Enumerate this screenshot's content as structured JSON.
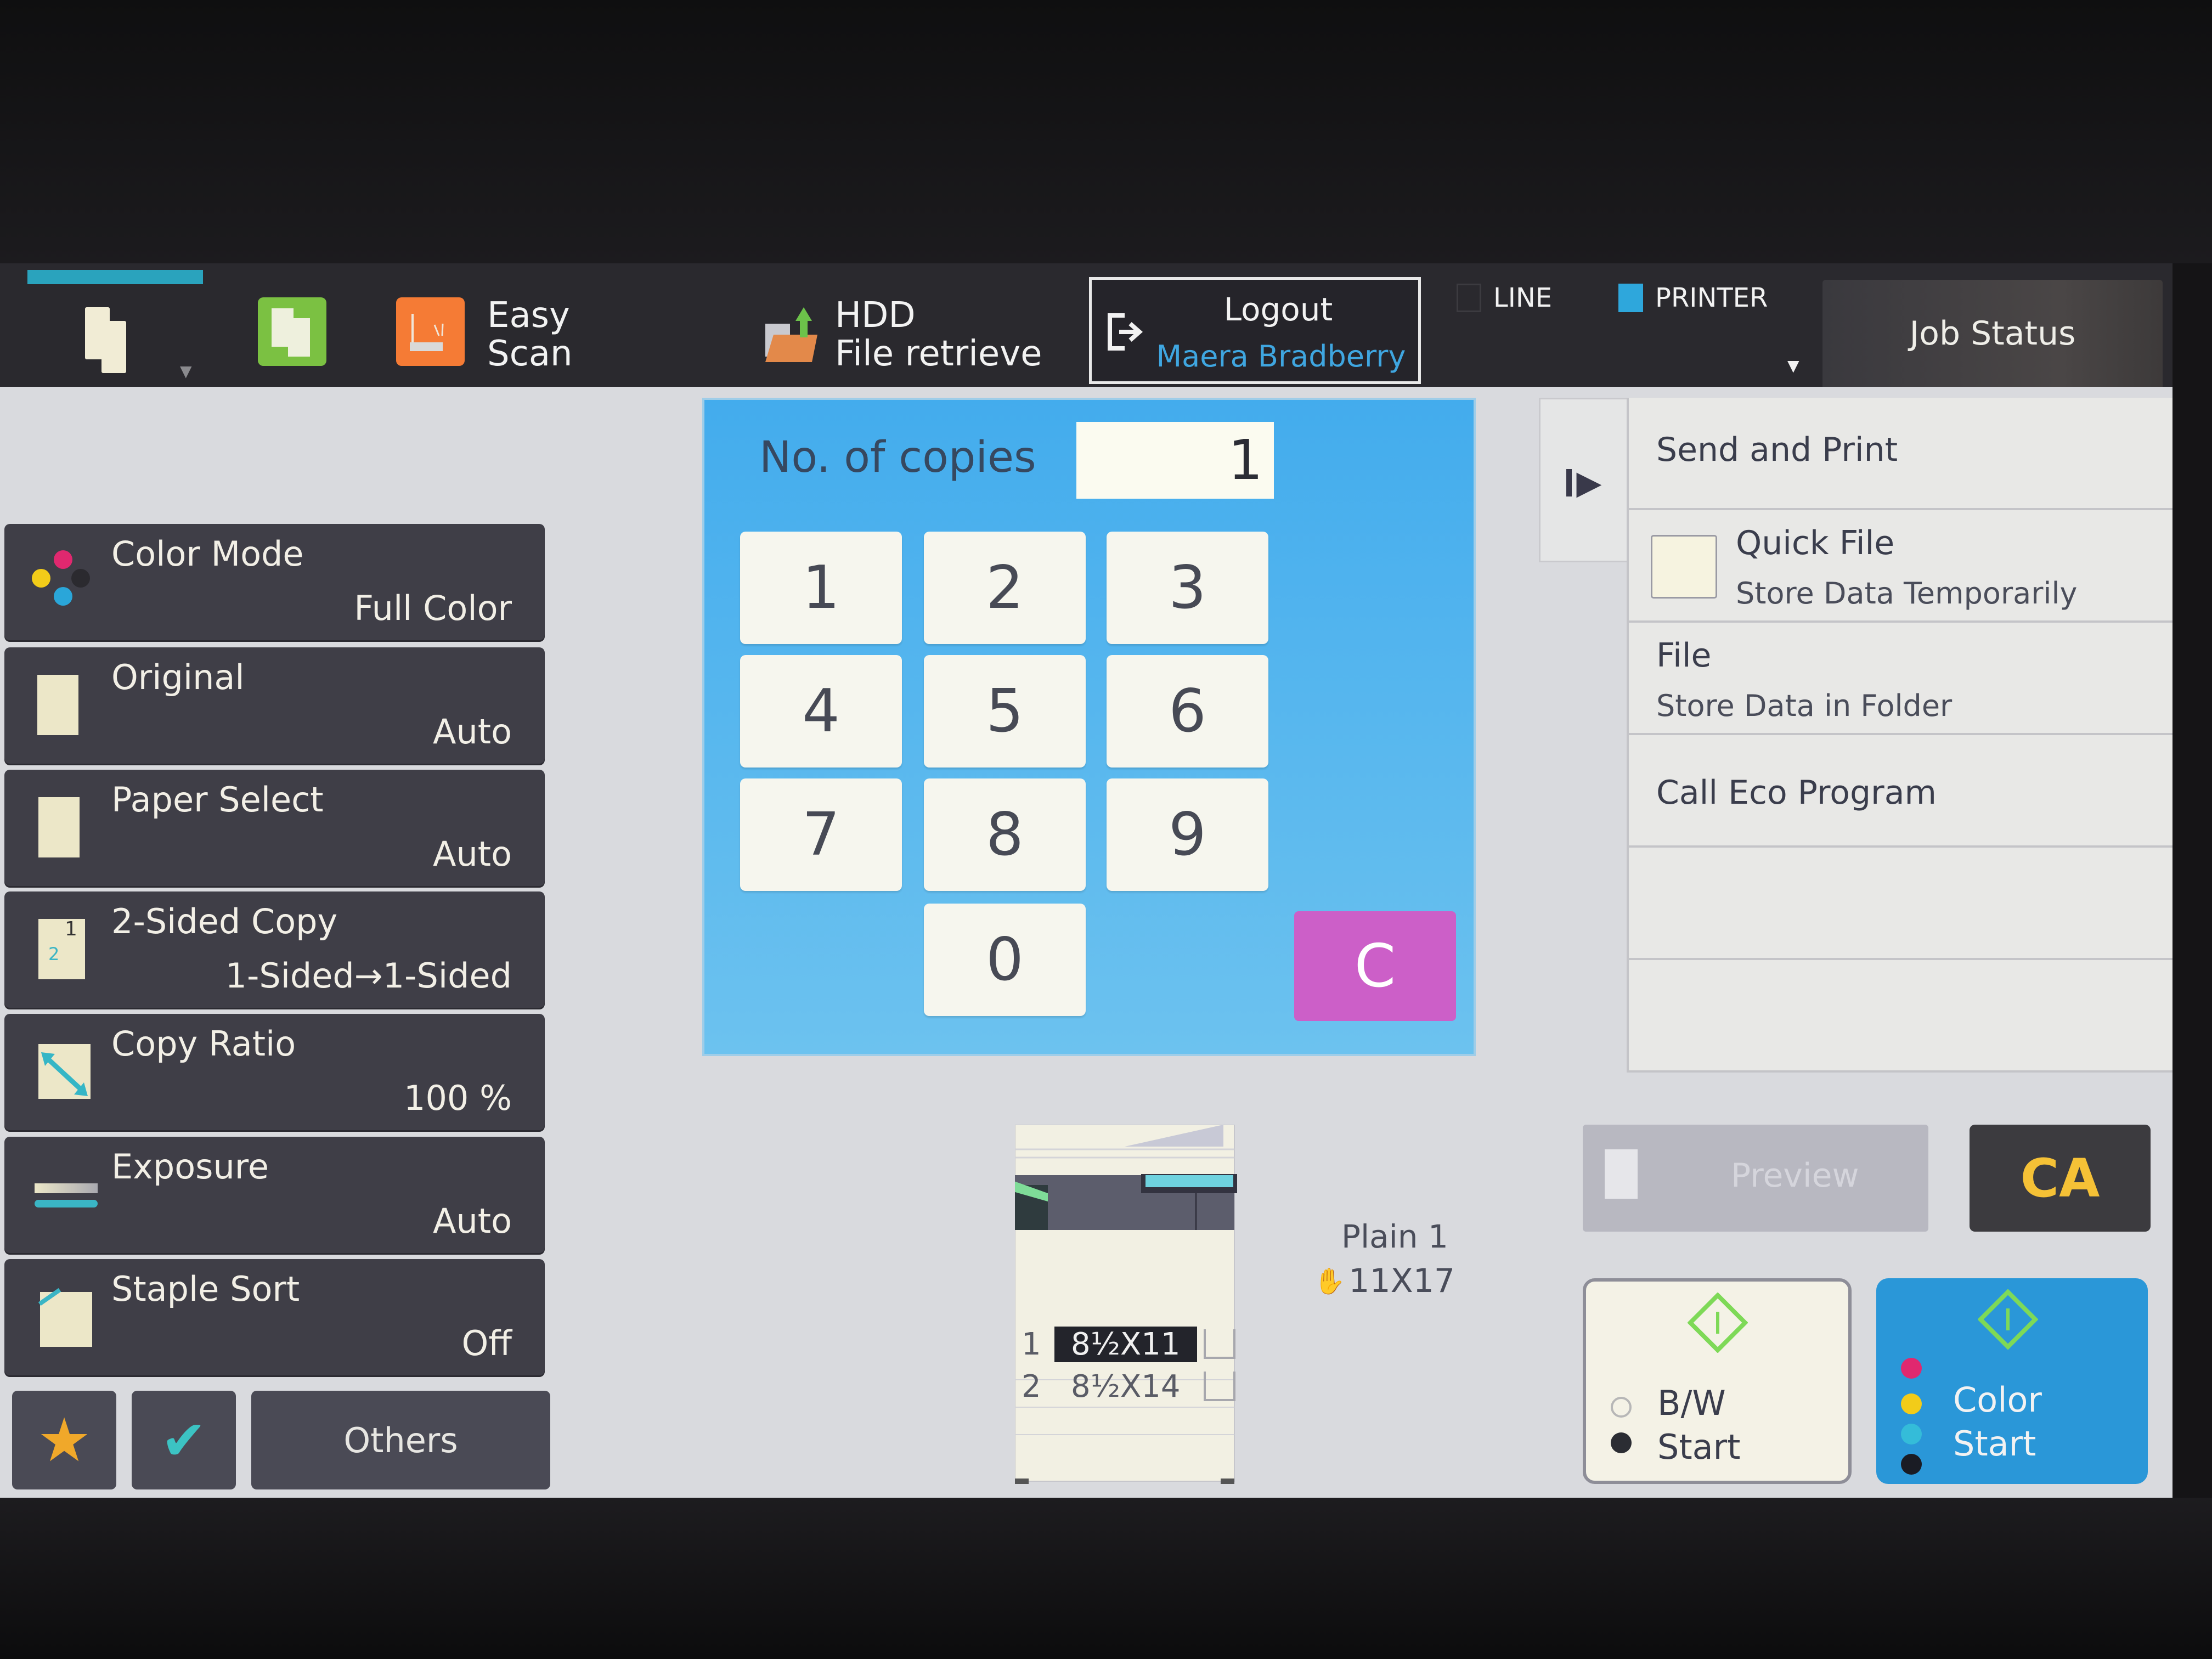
{
  "header": {
    "copy_mode_dropdown_glyph": "▼",
    "easy_scan": "Easy\nScan",
    "easy_scan_line1": "Easy",
    "easy_scan_line2": "Scan",
    "hdd_line1": "HDD",
    "hdd_line2": "File retrieve",
    "logout_label": "Logout",
    "logged_in_user": "Maera Bradberry",
    "indicators": [
      {
        "label": "LINE",
        "active": false
      },
      {
        "label": "PRINTER",
        "active": true,
        "color": "#2ea7dc"
      }
    ],
    "status_dropdown_glyph": "▼",
    "job_status_label": "Job Status"
  },
  "functions": [
    {
      "label": "Color Mode",
      "value": "Full Color",
      "icon": "color-dots-icon"
    },
    {
      "label": "Original",
      "value": "Auto",
      "icon": "document-icon"
    },
    {
      "label": "Paper Select",
      "value": "Auto",
      "icon": "paper-icon"
    },
    {
      "label": "2-Sided Copy",
      "value": "1-Sided→1-Sided",
      "icon": "duplex-icon"
    },
    {
      "label": "Copy Ratio",
      "value": "100 %",
      "icon": "ratio-icon"
    },
    {
      "label": "Exposure",
      "value": "Auto",
      "icon": "exposure-icon"
    },
    {
      "label": "Staple Sort",
      "value": "Off",
      "icon": "staple-icon"
    }
  ],
  "bottom_buttons": {
    "favorites_glyph": "★",
    "check_glyph": "✔",
    "others_label": "Others"
  },
  "keypad": {
    "copies_label": "No. of copies",
    "copies_value": "1",
    "keys": [
      "1",
      "2",
      "3",
      "4",
      "5",
      "6",
      "7",
      "8",
      "9",
      "0"
    ],
    "clear_label": "C"
  },
  "device": {
    "bypass_paper_type": "Plain 1",
    "bypass_paper_size": "11X17",
    "trays": [
      {
        "number": "1",
        "size": "8½X11",
        "selected": true
      },
      {
        "number": "2",
        "size": "8½X14",
        "selected": false
      }
    ]
  },
  "right_menu": {
    "expand_glyph": "▶",
    "items": [
      {
        "title": "Send and Print",
        "subtitle": ""
      },
      {
        "title": "Quick File",
        "subtitle": "Store Data Temporarily"
      },
      {
        "title": "File",
        "subtitle": "Store Data in Folder"
      },
      {
        "title": "Call Eco Program",
        "subtitle": ""
      },
      {
        "title": "",
        "subtitle": ""
      },
      {
        "title": "",
        "subtitle": ""
      }
    ]
  },
  "actions": {
    "preview_label": "Preview",
    "preview_enabled": false,
    "clear_all_label": "CA",
    "bw_start_line1": "B/W",
    "bw_start_line2": "Start",
    "color_start_line1": "Color",
    "color_start_line2": "Start"
  },
  "colors": {
    "accent_blue": "#2ea7dc",
    "clear_magenta": "#cc5fc8",
    "ca_yellow": "#f5c136",
    "start_green": "#7ed957"
  }
}
